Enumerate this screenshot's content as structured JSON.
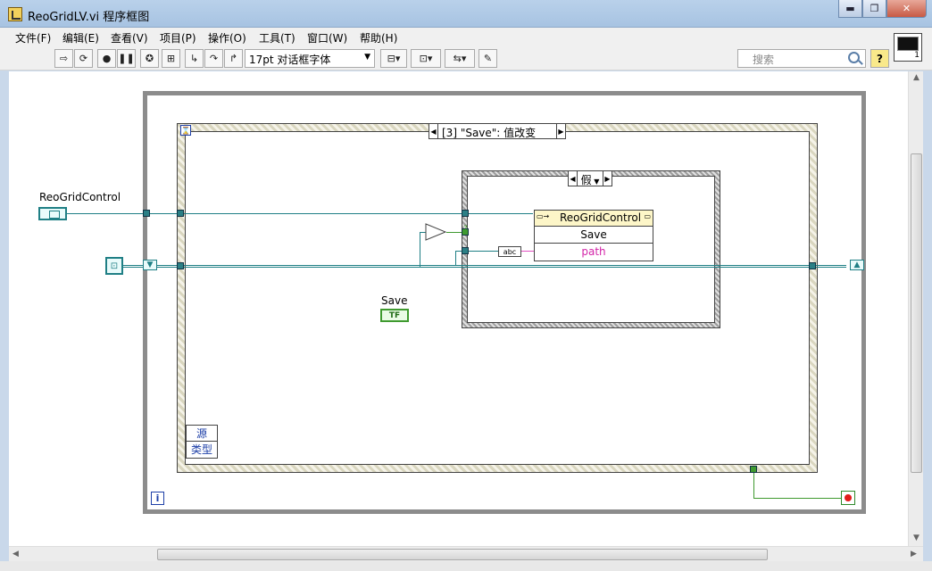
{
  "window": {
    "title": "ReoGridLV.vi 程序框图",
    "controls": {
      "minimize": "▬",
      "maximize": "❐",
      "close": "✕"
    }
  },
  "menu": [
    "文件(F)",
    "编辑(E)",
    "查看(V)",
    "项目(P)",
    "操作(O)",
    "工具(T)",
    "窗口(W)",
    "帮助(H)"
  ],
  "toolbar": {
    "font": "17pt 对话框字体",
    "search_placeholder": "搜索",
    "help": "?",
    "connector_number": "1"
  },
  "diagram": {
    "event_case_selector": "[3] \"Save\": 值改变",
    "inner_case_selector": "假",
    "control_label": "ReoGridControl",
    "save_label": "Save",
    "save_terminal_text": "TF",
    "invoke": {
      "class": "ReoGridControl",
      "method": "Save",
      "param": "path"
    },
    "event_data": [
      "源",
      "类型"
    ],
    "compare_text": "?",
    "to_string_text": "abc",
    "iteration": "i"
  },
  "colors": {
    "wire_ref": "#1f7f85",
    "wire_bool": "#3f9a2f",
    "wire_string": "#e24fc2"
  }
}
